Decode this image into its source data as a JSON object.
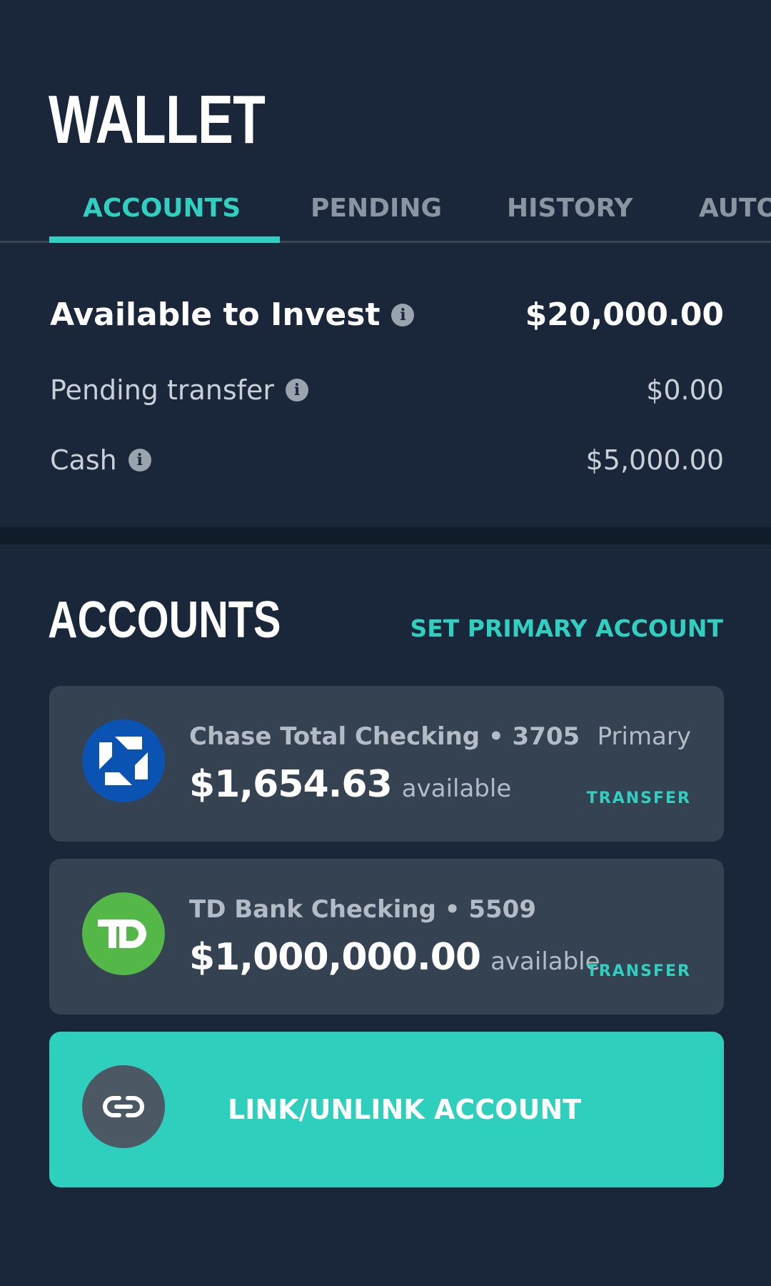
{
  "header": {
    "title": "WALLET"
  },
  "tabs": [
    {
      "label": "ACCOUNTS",
      "active": true
    },
    {
      "label": "PENDING",
      "active": false
    },
    {
      "label": "HISTORY",
      "active": false
    },
    {
      "label": "AUTO",
      "active": false
    }
  ],
  "summary": {
    "available": {
      "label": "Available to Invest",
      "value": "$20,000.00",
      "icon": "info-icon"
    },
    "pending": {
      "label": "Pending transfer",
      "value": "$0.00",
      "icon": "info-icon"
    },
    "cash": {
      "label": "Cash",
      "value": "$5,000.00",
      "icon": "info-icon"
    }
  },
  "accounts_section": {
    "title": "ACCOUNTS",
    "set_primary_label": "SET PRIMARY ACCOUNT",
    "items": [
      {
        "name": "Chase Total Checking • 3705",
        "balance": "$1,654.63",
        "available_label": "available",
        "primary_label": "Primary",
        "transfer_label": "TRANSFER",
        "logo": "chase-logo",
        "logo_color": "#0a53b3"
      },
      {
        "name": "TD Bank Checking • 5509",
        "balance": "$1,000,000.00",
        "available_label": "available",
        "transfer_label": "TRANSFER",
        "logo": "td-logo",
        "logo_color": "#53b848"
      }
    ]
  },
  "link_button": {
    "label": "LINK/UNLINK ACCOUNT",
    "icon": "link-icon"
  },
  "colors": {
    "background": "#1a263a",
    "accent": "#2fd0bf",
    "card": "#354252"
  }
}
